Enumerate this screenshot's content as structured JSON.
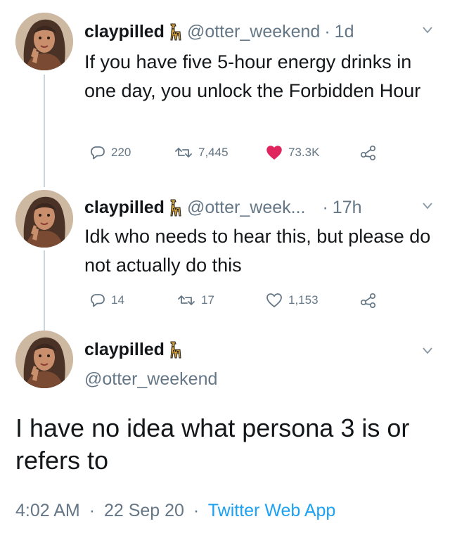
{
  "user": {
    "name": "claypilled",
    "handle": "@otter_weekend",
    "handle_truncated": "@otter_week..."
  },
  "tweets": [
    {
      "time": "1d",
      "text": "If you have five 5-hour energy drinks in one day, you unlock the Forbidden Hour",
      "replies": "220",
      "retweets": "7,445",
      "likes": "73.3K",
      "liked": true
    },
    {
      "time": "17h",
      "text": "Idk who needs to hear this, but please do not actually do this",
      "replies": "14",
      "retweets": "17",
      "likes": "1,153",
      "liked": false
    }
  ],
  "main_tweet": {
    "text": "I have no idea what persona 3 is or refers to",
    "time": "4:02 AM",
    "date": "22 Sep 20",
    "app": "Twitter Web App"
  },
  "separator": "·",
  "colors": {
    "text": "#14171a",
    "secondary": "#657786",
    "link": "#1da1f2",
    "like": "#e0245e",
    "thread_line": "#ccd6dd"
  },
  "icons": [
    "avatar",
    "giraffe-emoji-icon",
    "chevron-down-icon",
    "reply-icon",
    "retweet-icon",
    "heart-icon",
    "share-icon"
  ]
}
